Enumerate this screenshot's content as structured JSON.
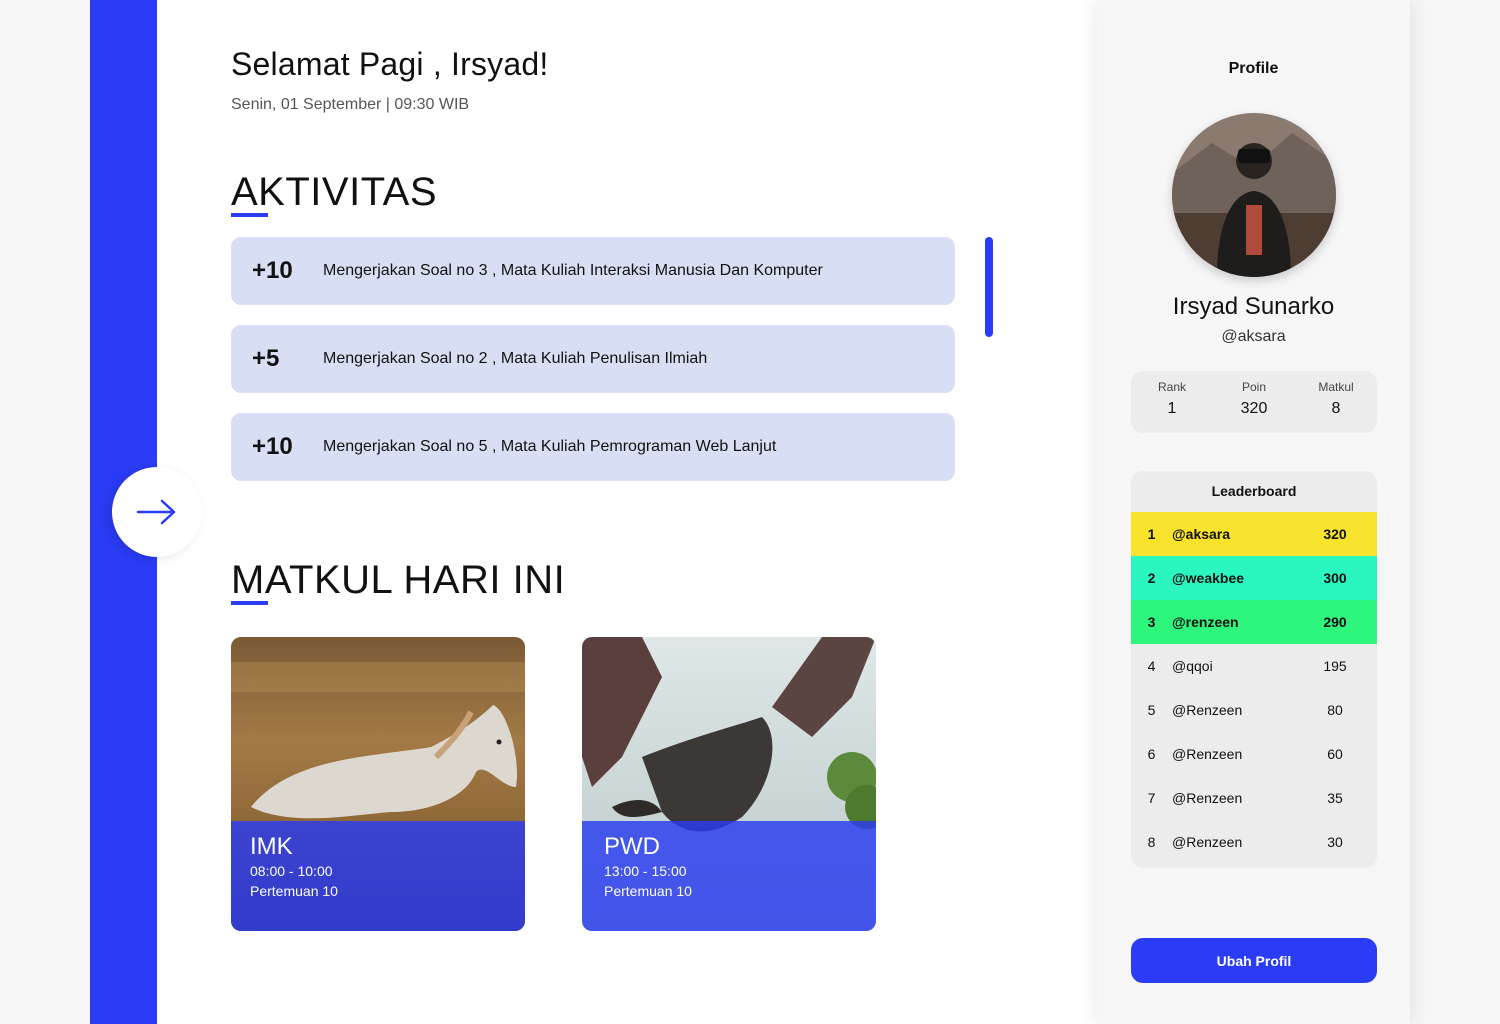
{
  "header": {
    "greeting": "Selamat Pagi , Irsyad!",
    "datetime": "Senin, 01 September | 09:30 WIB"
  },
  "activities": {
    "title": "AKTIVITAS",
    "items": [
      {
        "points": "+10",
        "text": "Mengerjakan Soal no 3 , Mata Kuliah Interaksi Manusia Dan Komputer"
      },
      {
        "points": "+5",
        "text": "Mengerjakan Soal no 2 , Mata Kuliah Penulisan Ilmiah"
      },
      {
        "points": "+10",
        "text": "Mengerjakan Soal no 5 , Mata Kuliah Pemrograman Web Lanjut"
      }
    ]
  },
  "courses": {
    "title": "MATKUL HARI INI",
    "items": [
      {
        "code": "IMK",
        "time": "08:00 - 10:00",
        "meeting": "Pertemuan 10",
        "image": "horse-photo"
      },
      {
        "code": "PWD",
        "time": "13:00 - 15:00",
        "meeting": "Pertemuan 10",
        "image": "dragon-photo"
      }
    ]
  },
  "profile": {
    "title": "Profile",
    "name": "Irsyad Sunarko",
    "handle": "@aksara",
    "avatar": "photographer-photo",
    "stats": [
      {
        "label": "Rank",
        "value": "1"
      },
      {
        "label": "Poin",
        "value": "320"
      },
      {
        "label": "Matkul",
        "value": "8"
      }
    ],
    "edit_button": "Ubah Profil"
  },
  "leaderboard": {
    "title": "Leaderboard",
    "rows": [
      {
        "rank": "1",
        "user": "@aksara",
        "points": "320",
        "color": "#f7e22c"
      },
      {
        "rank": "2",
        "user": "@weakbee",
        "points": "300",
        "color": "#2cf6c0"
      },
      {
        "rank": "3",
        "user": "@renzeen",
        "points": "290",
        "color": "#2ef57c"
      },
      {
        "rank": "4",
        "user": "@qqoi",
        "points": "195"
      },
      {
        "rank": "5",
        "user": "@Renzeen",
        "points": "80"
      },
      {
        "rank": "6",
        "user": "@Renzeen",
        "points": "60"
      },
      {
        "rank": "7",
        "user": "@Renzeen",
        "points": "35"
      },
      {
        "rank": "8",
        "user": "@Renzeen",
        "points": "30"
      }
    ]
  },
  "colors": {
    "accent": "#2a3cf5",
    "activity_bg": "#d8dff4",
    "panel_bg": "#f6f6f6"
  },
  "icons": {
    "expand": "arrow-right-icon"
  }
}
